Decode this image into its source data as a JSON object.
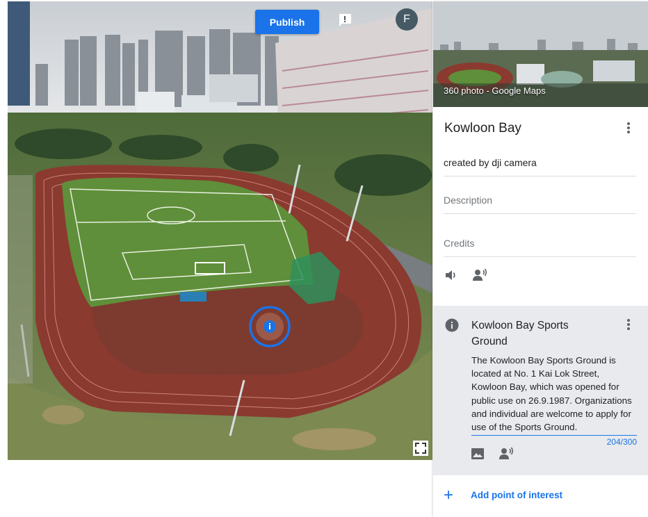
{
  "viewer": {
    "publish_label": "Publish",
    "avatar_letter": "F",
    "poi_marker_icon": "info-icon"
  },
  "panel": {
    "thumbnail_label": "360 photo - Google Maps",
    "thumbnail_icon": "360-rotate-icon",
    "title": "Kowloon Bay",
    "created_by": "created by dji camera",
    "description_placeholder": "Description",
    "credits_placeholder": "Credits",
    "icons": [
      "audio-icon",
      "voice-record-icon"
    ]
  },
  "poi": {
    "title": "Kowloon Bay Sports Ground",
    "description": "The Kowloon Bay Sports Ground is located at No. 1 Kai Lok Street, Kowloon Bay, which was opened for public use on 26.9.1987. Organizations and individual are welcome to apply for use of the Sports Ground.",
    "char_count": "204/300",
    "icons": [
      "image-icon",
      "voice-record-icon"
    ]
  },
  "add_poi": {
    "label": "Add point of interest",
    "icon": "plus-icon"
  },
  "colors": {
    "accent": "#1a73e8",
    "track": "#8b3a2f",
    "field": "#5f8f3a",
    "card_bg": "#e8eaed"
  }
}
